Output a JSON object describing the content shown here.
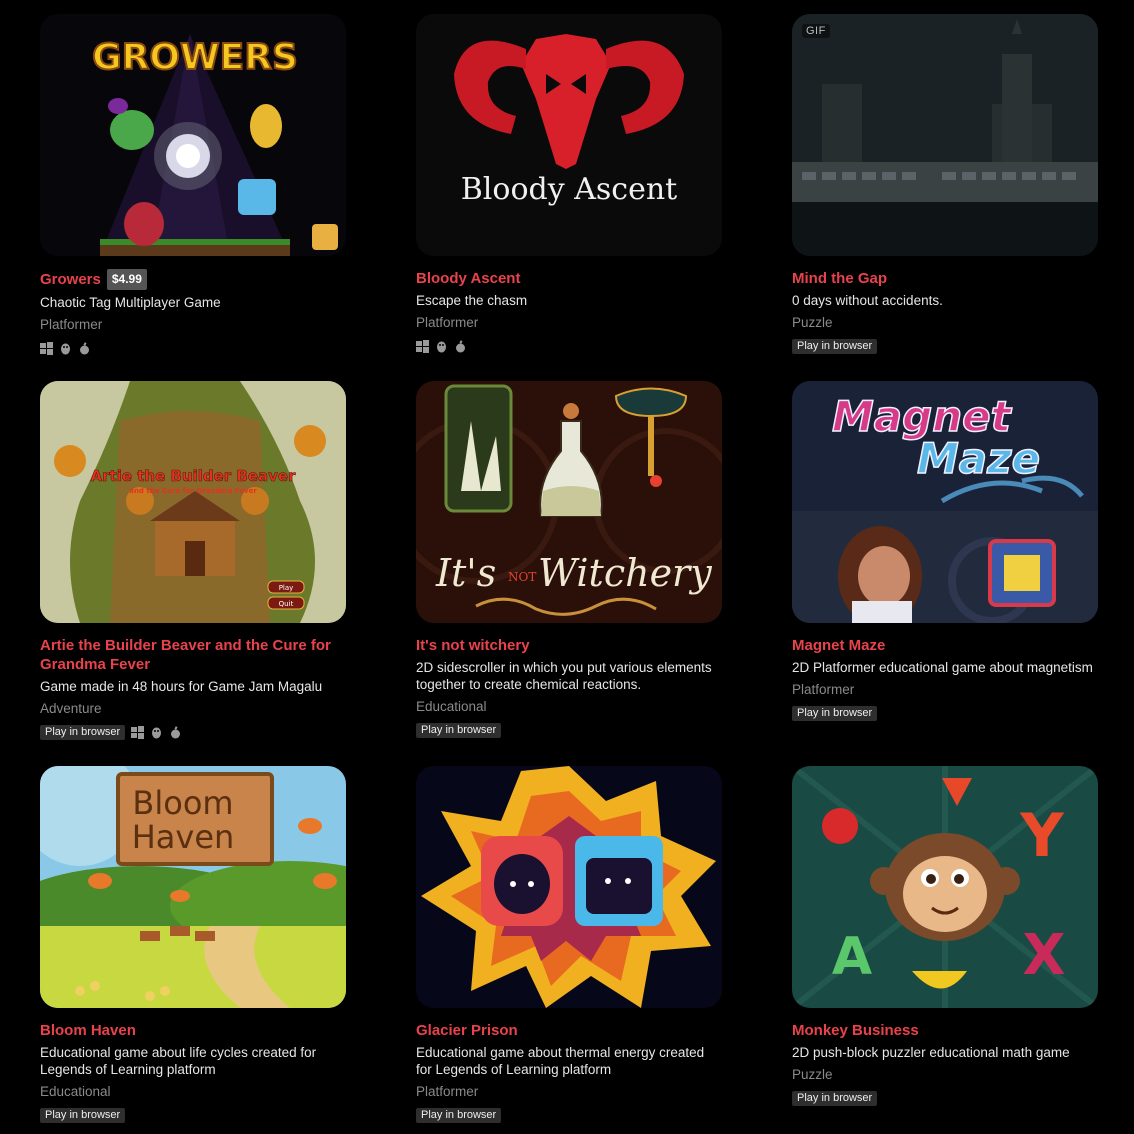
{
  "games": [
    {
      "title": "Growers",
      "price": "$4.99",
      "description": "Chaotic Tag Multiplayer Game",
      "genre": "Platformer",
      "play_in_browser": "",
      "platforms": [
        "windows-icon",
        "linux-icon",
        "apple-icon"
      ],
      "thumb_text": "GROWERS"
    },
    {
      "title": "Bloody Ascent",
      "price": "",
      "description": "Escape the chasm",
      "genre": "Platformer",
      "play_in_browser": "",
      "platforms": [
        "windows-icon",
        "linux-icon",
        "apple-icon"
      ],
      "thumb_text": "Bloody Ascent"
    },
    {
      "title": "Mind the Gap",
      "price": "",
      "description": "0 days without accidents.",
      "genre": "Puzzle",
      "play_in_browser": "Play in browser",
      "platforms": [],
      "thumb_text": "",
      "gif_label": "GIF"
    },
    {
      "title": "Artie the Builder Beaver and the Cure for Grandma Fever",
      "price": "",
      "description": "Game made in 48 hours for Game Jam Magalu",
      "genre": "Adventure",
      "play_in_browser": "Play in browser",
      "platforms": [
        "windows-icon",
        "linux-icon",
        "apple-icon"
      ],
      "thumb_text": "Artie the Builder Beaver",
      "thumb_subtext": "and the Cure for Grandma Fever",
      "thumb_play": "Play",
      "thumb_quit": "Quit"
    },
    {
      "title": "It's not witchery",
      "price": "",
      "description": "2D sidescroller in which you put various elements together to create chemical reactions.",
      "genre": "Educational",
      "play_in_browser": "Play in browser",
      "platforms": [],
      "thumb_text": "It's",
      "thumb_text2": "NOT",
      "thumb_text3": "Witchery"
    },
    {
      "title": "Magnet Maze",
      "price": "",
      "description": "2D Platformer educational game about magnetism",
      "genre": "Platformer",
      "play_in_browser": "Play in browser",
      "platforms": [],
      "thumb_text": "Magnet",
      "thumb_text2": "Maze"
    },
    {
      "title": "Bloom Haven",
      "price": "",
      "description": "Educational game about life cycles created for Legends of Learning platform",
      "genre": "Educational",
      "play_in_browser": "Play in browser",
      "platforms": [],
      "thumb_text": "Bloom",
      "thumb_text2": "Haven"
    },
    {
      "title": "Glacier Prison",
      "price": "",
      "description": "Educational game about thermal energy created for Legends of Learning platform",
      "genre": "Platformer",
      "play_in_browser": "Play in browser",
      "platforms": [],
      "thumb_text": ""
    },
    {
      "title": "Monkey Business",
      "price": "",
      "description": "2D push-block puzzler educational math game",
      "genre": "Puzzle",
      "play_in_browser": "Play in browser",
      "platforms": [],
      "thumb_text": "",
      "thumb_letters": [
        "Y",
        "A",
        "X"
      ]
    }
  ],
  "colors": {
    "background": "#000000",
    "title": "#e8434c",
    "genre": "#8a8a8a"
  }
}
